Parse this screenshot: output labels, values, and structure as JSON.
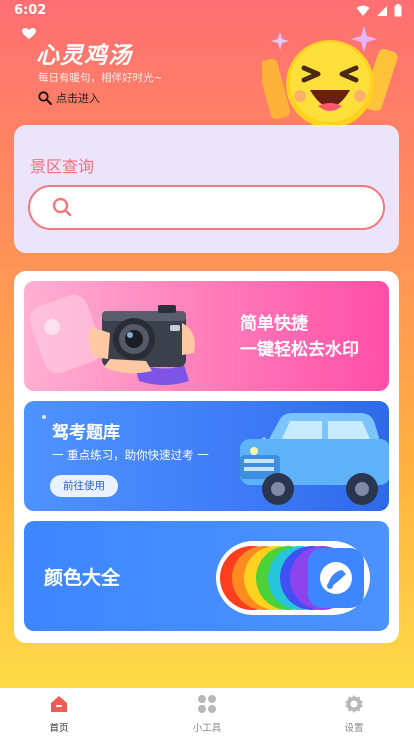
{
  "status_bar": {
    "time": "6:02"
  },
  "header": {
    "app_title": "心灵鸡汤",
    "subtitle": "每日有暖句，相伴好时光~",
    "enter_link": "点击进入"
  },
  "search": {
    "title": "景区查询",
    "placeholder": "",
    "value": ""
  },
  "tools": {
    "watermark": {
      "line1": "简单快捷",
      "line2": "一键轻松去水印"
    },
    "driving": {
      "title": "驾考题库",
      "subtitle": "一  重点练习，助你快速过考  一",
      "button": "前往使用"
    },
    "colors": {
      "title": "颜色大全"
    }
  },
  "nav": {
    "items": [
      {
        "label": "首页",
        "icon": "home-icon",
        "active": true
      },
      {
        "label": "小工具",
        "icon": "grid-icon",
        "active": false
      },
      {
        "label": "设置",
        "icon": "gear-icon",
        "active": false
      }
    ]
  },
  "colors": {
    "accent": "#F07A7E",
    "nav_active": "#F25C55",
    "nav_inactive": "#B8B8B8",
    "rainbow": [
      "#FF3D1F",
      "#FF8A1F",
      "#FFD21F",
      "#4CD137",
      "#26C6DA",
      "#3F51F5",
      "#8E44EC"
    ]
  }
}
